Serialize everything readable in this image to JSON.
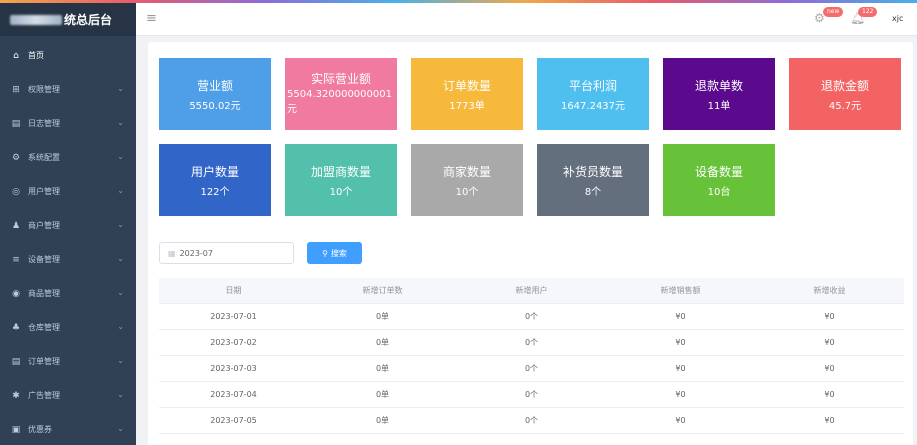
{
  "app": {
    "title": "统总后台"
  },
  "header": {
    "badge_new": "new",
    "badge_count": "122",
    "username": "xjc"
  },
  "sidebar": {
    "items": [
      {
        "label": "首页",
        "icon": "home-icon",
        "glyph": "⌂",
        "chev": ""
      },
      {
        "label": "权限管理",
        "icon": "grid-icon",
        "glyph": "⊞",
        "chev": "⌄"
      },
      {
        "label": "日志管理",
        "icon": "document-icon",
        "glyph": "▤",
        "chev": "⌄"
      },
      {
        "label": "系统配置",
        "icon": "gear-icon",
        "glyph": "⚙",
        "chev": "⌄"
      },
      {
        "label": "用户管理",
        "icon": "user-circle-icon",
        "glyph": "◎",
        "chev": "⌄"
      },
      {
        "label": "商户管理",
        "icon": "person-icon",
        "glyph": "♟",
        "chev": "⌄"
      },
      {
        "label": "设备管理",
        "icon": "list-icon",
        "glyph": "≡",
        "chev": "⌄"
      },
      {
        "label": "商品管理",
        "icon": "goods-icon",
        "glyph": "◉",
        "chev": "⌄"
      },
      {
        "label": "仓库管理",
        "icon": "warehouse-icon",
        "glyph": "♣",
        "chev": "⌄"
      },
      {
        "label": "订单管理",
        "icon": "order-icon",
        "glyph": "▤",
        "chev": "⌄"
      },
      {
        "label": "广告管理",
        "icon": "ad-icon",
        "glyph": "✱",
        "chev": "⌄"
      },
      {
        "label": "优惠券",
        "icon": "coupon-icon",
        "glyph": "▣",
        "chev": "⌄"
      }
    ]
  },
  "stats": [
    {
      "label": "营业额",
      "value": "5550.02元",
      "color": "#4f9ee8"
    },
    {
      "label": "实际营业额",
      "value": "5504.320000000001元",
      "color": "#f07aa0"
    },
    {
      "label": "订单数量",
      "value": "1773单",
      "color": "#f7b93b"
    },
    {
      "label": "平台利润",
      "value": "1647.2437元",
      "color": "#4fbff0"
    },
    {
      "label": "退款单数",
      "value": "11单",
      "color": "#5b0a8e"
    },
    {
      "label": "退款金额",
      "value": "45.7元",
      "color": "#f36363"
    },
    {
      "label": "用户数量",
      "value": "122个",
      "color": "#3265c8"
    },
    {
      "label": "加盟商数量",
      "value": "10个",
      "color": "#52c0aa"
    },
    {
      "label": "商家数量",
      "value": "10个",
      "color": "#a9a9a9"
    },
    {
      "label": "补货员数量",
      "value": "8个",
      "color": "#646f7e"
    },
    {
      "label": "设备数量",
      "value": "10台",
      "color": "#67c23a"
    }
  ],
  "filter": {
    "date_value": "2023-07",
    "search_label": "搜索"
  },
  "table": {
    "headers": [
      "日期",
      "新增订单数",
      "新增用户",
      "新增销售额",
      "新增收益"
    ],
    "rows": [
      [
        "2023-07-01",
        "0单",
        "0个",
        "¥0",
        "¥0"
      ],
      [
        "2023-07-02",
        "0单",
        "0个",
        "¥0",
        "¥0"
      ],
      [
        "2023-07-03",
        "0单",
        "0个",
        "¥0",
        "¥0"
      ],
      [
        "2023-07-04",
        "0单",
        "0个",
        "¥0",
        "¥0"
      ],
      [
        "2023-07-05",
        "0单",
        "0个",
        "¥0",
        "¥0"
      ]
    ]
  }
}
